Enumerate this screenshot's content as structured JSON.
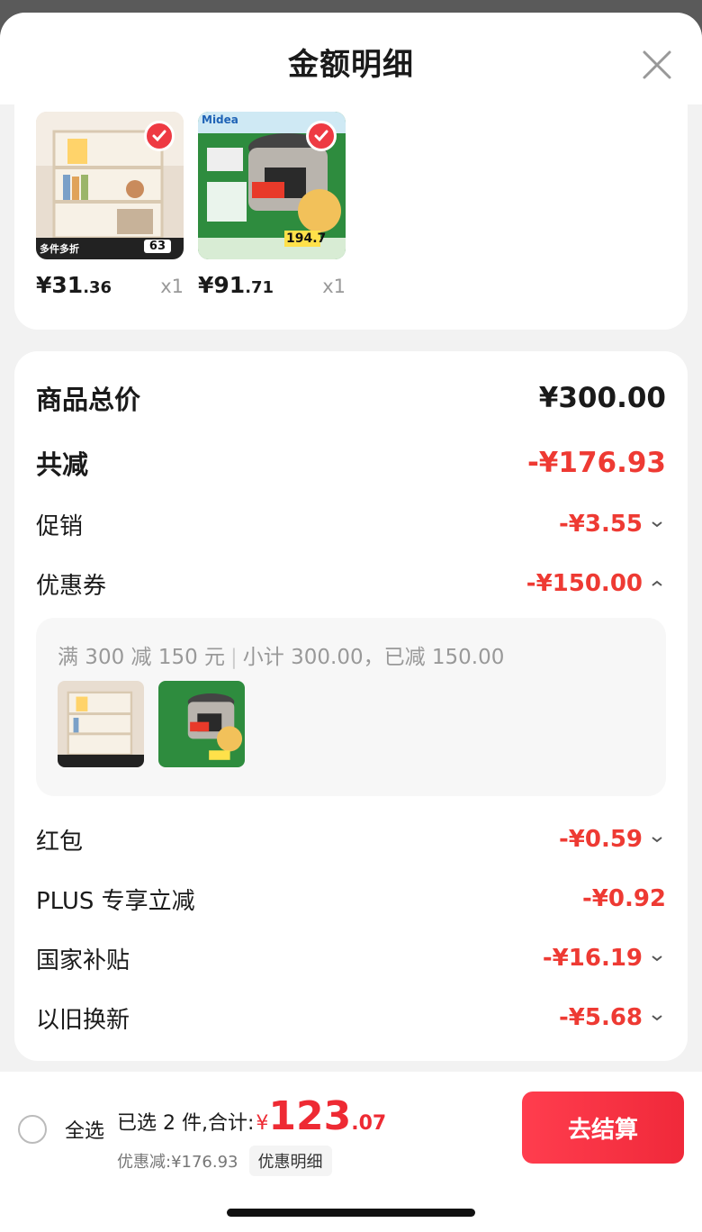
{
  "header": {
    "title": "金额明细"
  },
  "products": [
    {
      "price_int": "¥31",
      "price_dec": ".36",
      "qty": "x1",
      "badge_left": "多件多折",
      "badge_right": "63"
    },
    {
      "price_int": "¥91",
      "price_dec": ".71",
      "qty": "x1",
      "brand": "Midea",
      "promo_price": "194.7"
    }
  ],
  "summary": {
    "total_label": "商品总价",
    "total_value": "¥300.00",
    "reduction_label": "共减",
    "reduction_value": "-¥176.93",
    "promo_label": "促销",
    "promo_value": "-¥3.55",
    "coupon_label": "优惠券",
    "coupon_value": "-¥150.00",
    "coupon_rule": "满 300 减 150 元",
    "coupon_subtotal": "小计 300.00，已减 150.00",
    "redpacket_label": "红包",
    "redpacket_value": "-¥0.59",
    "plus_label": "PLUS 专享立减",
    "plus_value": "-¥0.92",
    "subsidy_label": "国家补贴",
    "subsidy_value": "-¥16.19",
    "tradein_label": "以旧换新",
    "tradein_value": "-¥5.68"
  },
  "footer": {
    "select_all": "全选",
    "selected_text": "已选 2 件,合计:",
    "currency": "¥",
    "total_int": "123",
    "total_dec": ".07",
    "discount_text": "优惠减:¥176.93",
    "detail_link": "优惠明细",
    "checkout": "去结算"
  },
  "colors": {
    "accent": "#ee3a33",
    "button": "#f0293a"
  },
  "icons": [
    "close-icon",
    "check-icon",
    "chevron-down-icon",
    "chevron-up-icon"
  ]
}
